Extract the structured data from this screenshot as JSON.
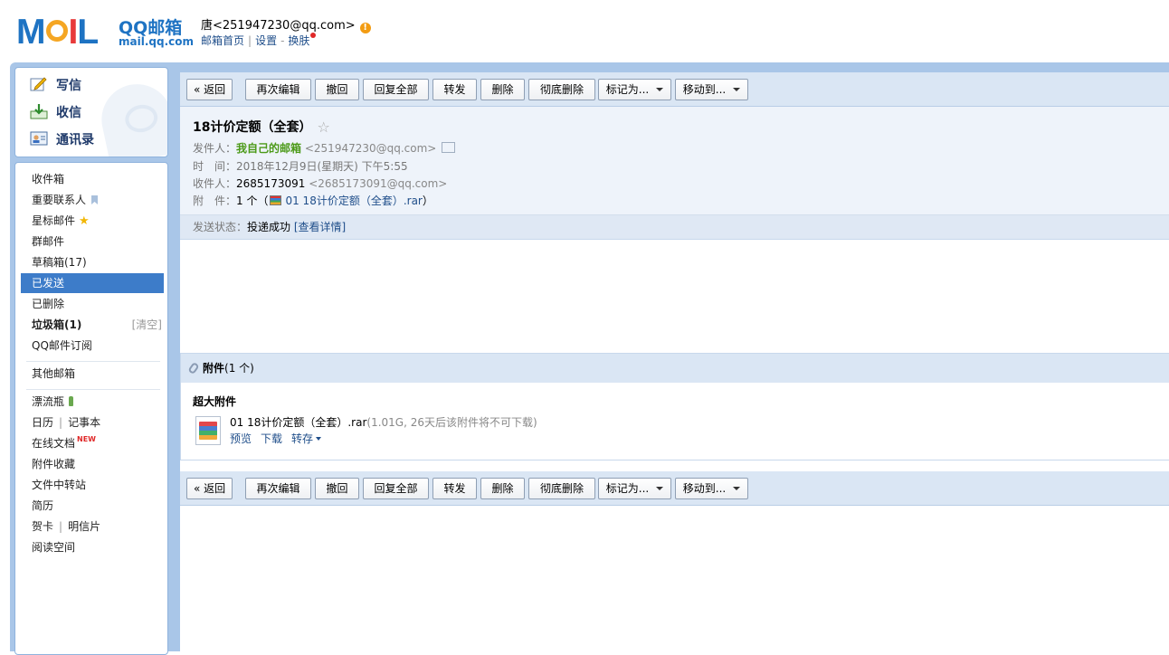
{
  "header": {
    "logo_text": "MOIL",
    "logo_cn": "QQ邮箱",
    "logo_domain": "mail.qq.com",
    "user_display": "唐<251947230@qq.com>",
    "links": {
      "home": "邮箱首页",
      "settings": "设置",
      "skin": "换肤"
    }
  },
  "sidebar": {
    "quick": {
      "compose": "写信",
      "inbox": "收信",
      "contacts": "通讯录"
    },
    "folders": {
      "inbox": "收件箱",
      "vip": "重要联系人",
      "starred": "星标邮件",
      "group": "群邮件",
      "drafts": "草稿箱(17)",
      "sent": "已发送",
      "deleted": "已删除",
      "spam": "垃圾箱(1)",
      "spam_clear": "[清空]",
      "subscriptions": "QQ邮件订阅",
      "other_mailboxes": "其他邮箱",
      "drift_bottle": "漂流瓶",
      "calendar": "日历",
      "notebook": "记事本",
      "online_docs": "在线文档",
      "online_docs_badge": "NEW",
      "attachment_collection": "附件收藏",
      "file_transfer": "文件中转站",
      "resume": "简历",
      "greeting_card": "贺卡",
      "postcard": "明信片",
      "reading_space": "阅读空间"
    }
  },
  "toolbar": {
    "back": "« 返回",
    "edit_again": "再次编辑",
    "recall": "撤回",
    "reply_all": "回复全部",
    "forward": "转发",
    "delete": "删除",
    "delete_permanently": "彻底删除",
    "mark_as": "标记为...",
    "move_to": "移动到..."
  },
  "mail": {
    "subject": "18计价定额（全套）",
    "sender_label": "发件人：",
    "sender_name": "我自己的邮箱",
    "sender_addr": "<251947230@qq.com>",
    "time_label": "时　间：",
    "time_value": "2018年12月9日(星期天) 下午5:55",
    "recipient_label": "收件人：",
    "recipient_name": "2685173091",
    "recipient_addr": "<2685173091@qq.com>",
    "attach_label": "附　件：",
    "attach_count": "1 个（",
    "attach_name": "01 18计价定额（全套）.rar",
    "attach_close": "）",
    "status_label": "发送状态：",
    "status_value": "投递成功",
    "status_link": "[查看详情]"
  },
  "attachments": {
    "title": "附件",
    "count": "(1 个)",
    "section_label": "超大附件",
    "file": {
      "name": "01 18计价定额（全套）.rar",
      "meta": "(1.01G, 26天后该附件将不可下载)",
      "preview": "预览",
      "download": "下载",
      "save": "转存"
    }
  }
}
